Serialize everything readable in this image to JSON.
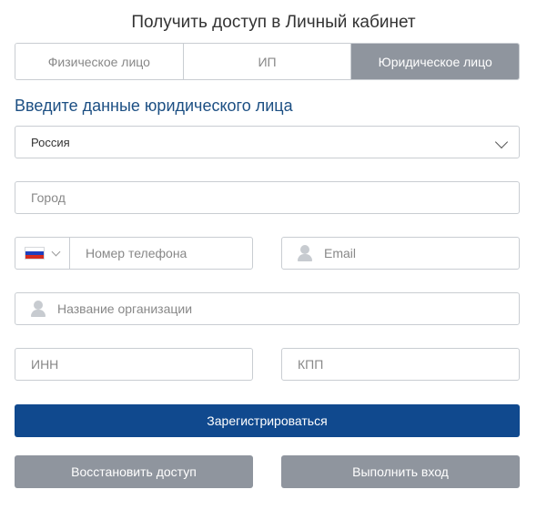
{
  "title": "Получить доступ в Личный кабинет",
  "tabs": [
    {
      "label": "Физическое лицо",
      "active": false
    },
    {
      "label": "ИП",
      "active": false
    },
    {
      "label": "Юридическое лицо",
      "active": true
    }
  ],
  "subtitle": "Введите данные юридического лица",
  "country": {
    "value": "Россия",
    "icon": "chevron-down-icon"
  },
  "city": {
    "placeholder": "Город"
  },
  "phone": {
    "flag": "russia-flag-icon",
    "placeholder": "Номер телефона"
  },
  "email": {
    "placeholder": "Email",
    "icon": "person-icon"
  },
  "organization": {
    "placeholder": "Название организации",
    "icon": "person-icon"
  },
  "inn": {
    "placeholder": "ИНН"
  },
  "kpp": {
    "placeholder": "КПП"
  },
  "buttons": {
    "register": "Зарегистрироваться",
    "restore": "Восстановить доступ",
    "login": "Выполнить вход"
  },
  "colors": {
    "primary": "#10498e",
    "secondary": "#8f959e",
    "heading": "#1c4f83"
  }
}
